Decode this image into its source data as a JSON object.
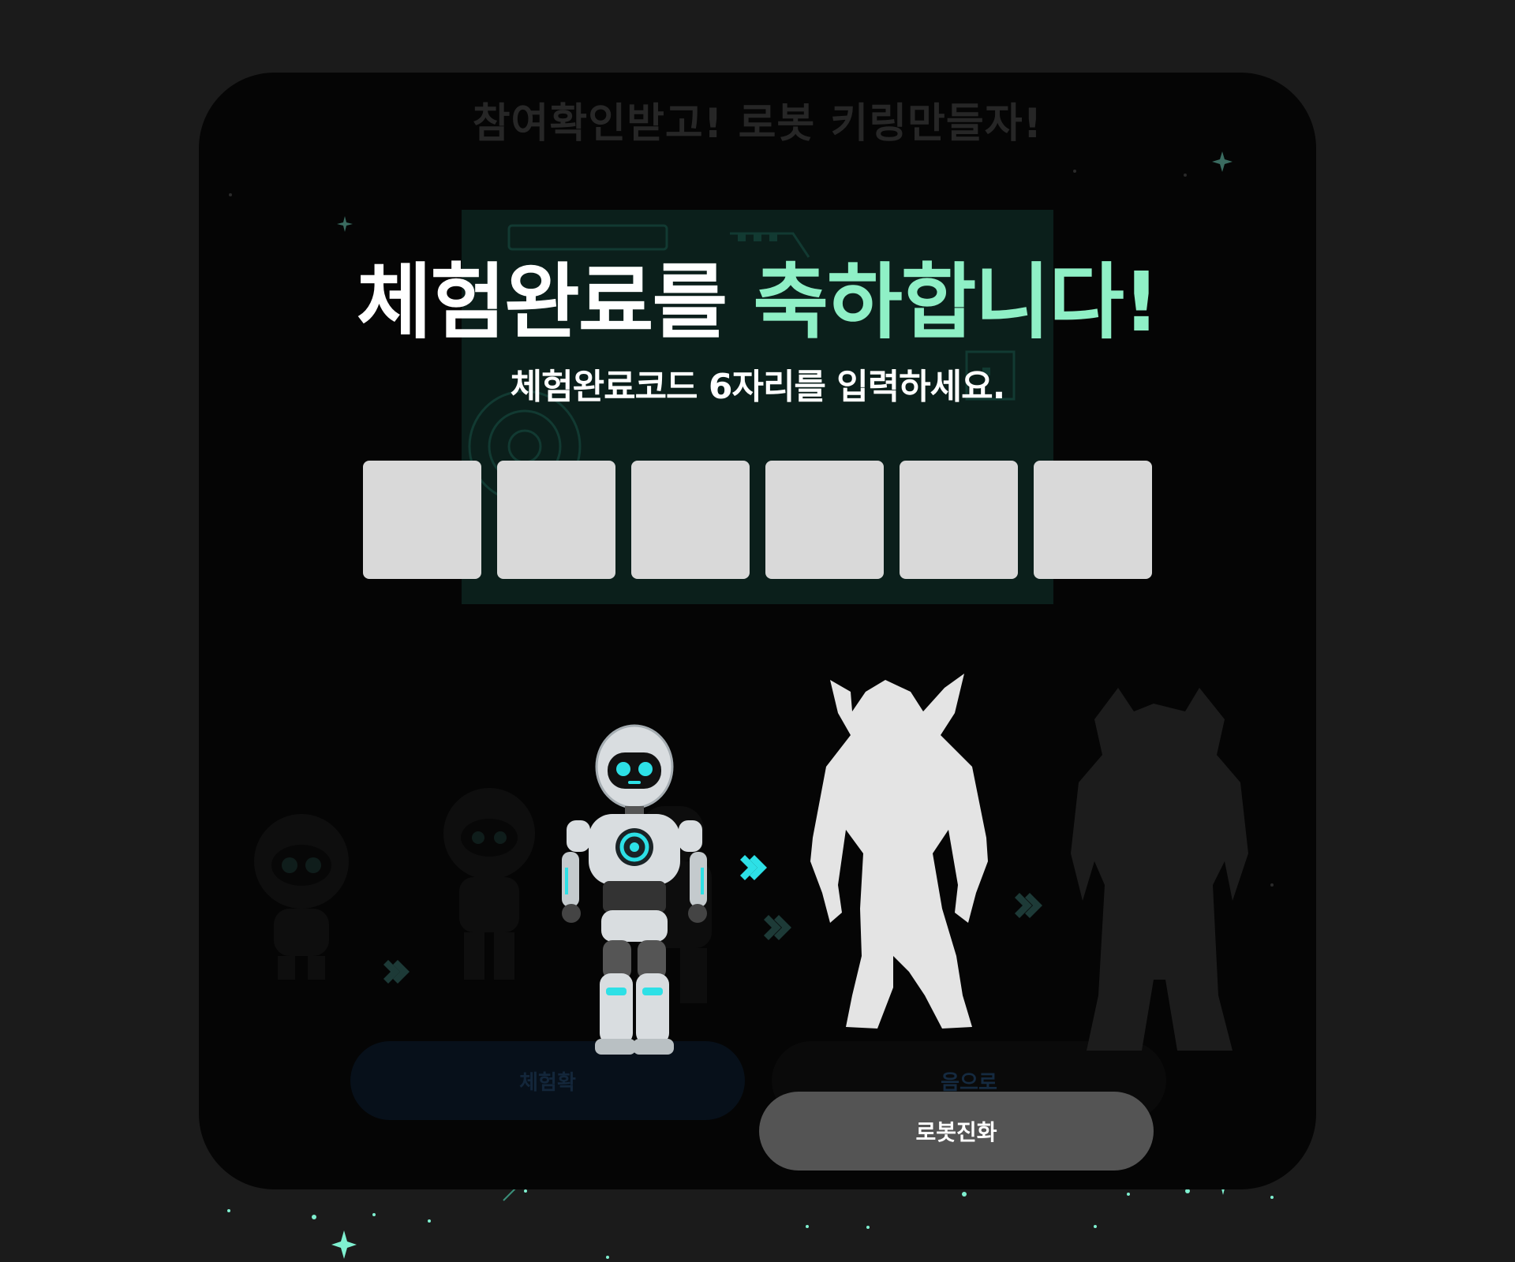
{
  "background_title": "참여확인받고! 로봇 키링만들자!",
  "modal": {
    "title_main": "체험완료를",
    "title_accent": "축하합니다!",
    "subtitle": "체험완료코드 6자리를 입력하세요.",
    "code_inputs": [
      "",
      "",
      "",
      "",
      "",
      ""
    ]
  },
  "background_buttons": {
    "left_label": "체험확",
    "right_label": "음으로"
  },
  "evolve_button_label": "로봇진화",
  "colors": {
    "accent": "#8ff0c6",
    "robot_glow": "#2de0e6",
    "silhouette": "#e4e4e4",
    "button": "#545454",
    "code_box": "#d9d9d9"
  },
  "icons": [
    "robot-image",
    "chevron-right-icon",
    "robot-silhouette",
    "sparkle-icon"
  ]
}
